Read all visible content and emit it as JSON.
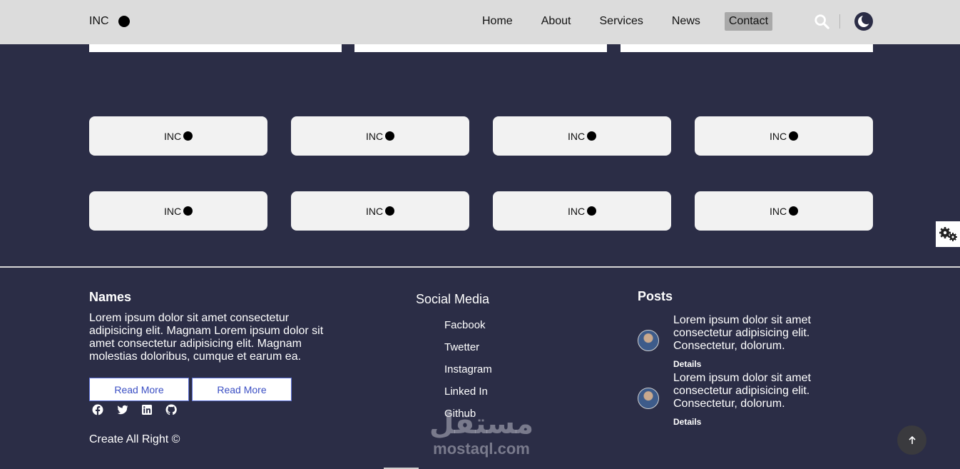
{
  "header": {
    "logo_text": "INC",
    "nav": [
      "Home",
      "About",
      "Services",
      "News",
      "Contact"
    ],
    "active_nav": "Contact",
    "icons": [
      "search-icon",
      "moon-icon"
    ]
  },
  "tiles": [
    "INC",
    "INC",
    "INC",
    "INC",
    "INC",
    "INC",
    "INC",
    "INC"
  ],
  "footer": {
    "names": {
      "title": "Names",
      "text": "Lorem ipsum dolor sit amet consectetur adipisicing elit. Magnam Lorem ipsum dolor sit amet consectetur adipisicing elit. Magnam molestias doloribus, cumque et earum ea.",
      "buttons": [
        "Read More",
        "Read More"
      ],
      "social_icons": [
        "facebook-icon",
        "twitter-icon",
        "linkedin-icon",
        "github-icon"
      ],
      "copyright": "Create All Right ©"
    },
    "social_media": {
      "title": "Social Media",
      "links": [
        "Facbook",
        "Twetter",
        "Instagram",
        "Linked In",
        "Github"
      ]
    },
    "posts": {
      "title": "Posts",
      "items": [
        {
          "text": "Lorem ipsum dolor sit amet consectetur adipisicing elit. Consectetur, dolorum.",
          "details": "Details"
        },
        {
          "text": "Lorem ipsum dolor sit amet consectetur adipisicing elit. Consectetur, dolorum.",
          "details": "Details"
        }
      ]
    }
  },
  "watermark": {
    "arabic": "مستقل",
    "latin": "mostaql.com"
  },
  "colors": {
    "background": "#2b2d46",
    "header": "#dcdcdc",
    "tile": "#f2f2f2",
    "button_border": "#5b6fd6"
  }
}
